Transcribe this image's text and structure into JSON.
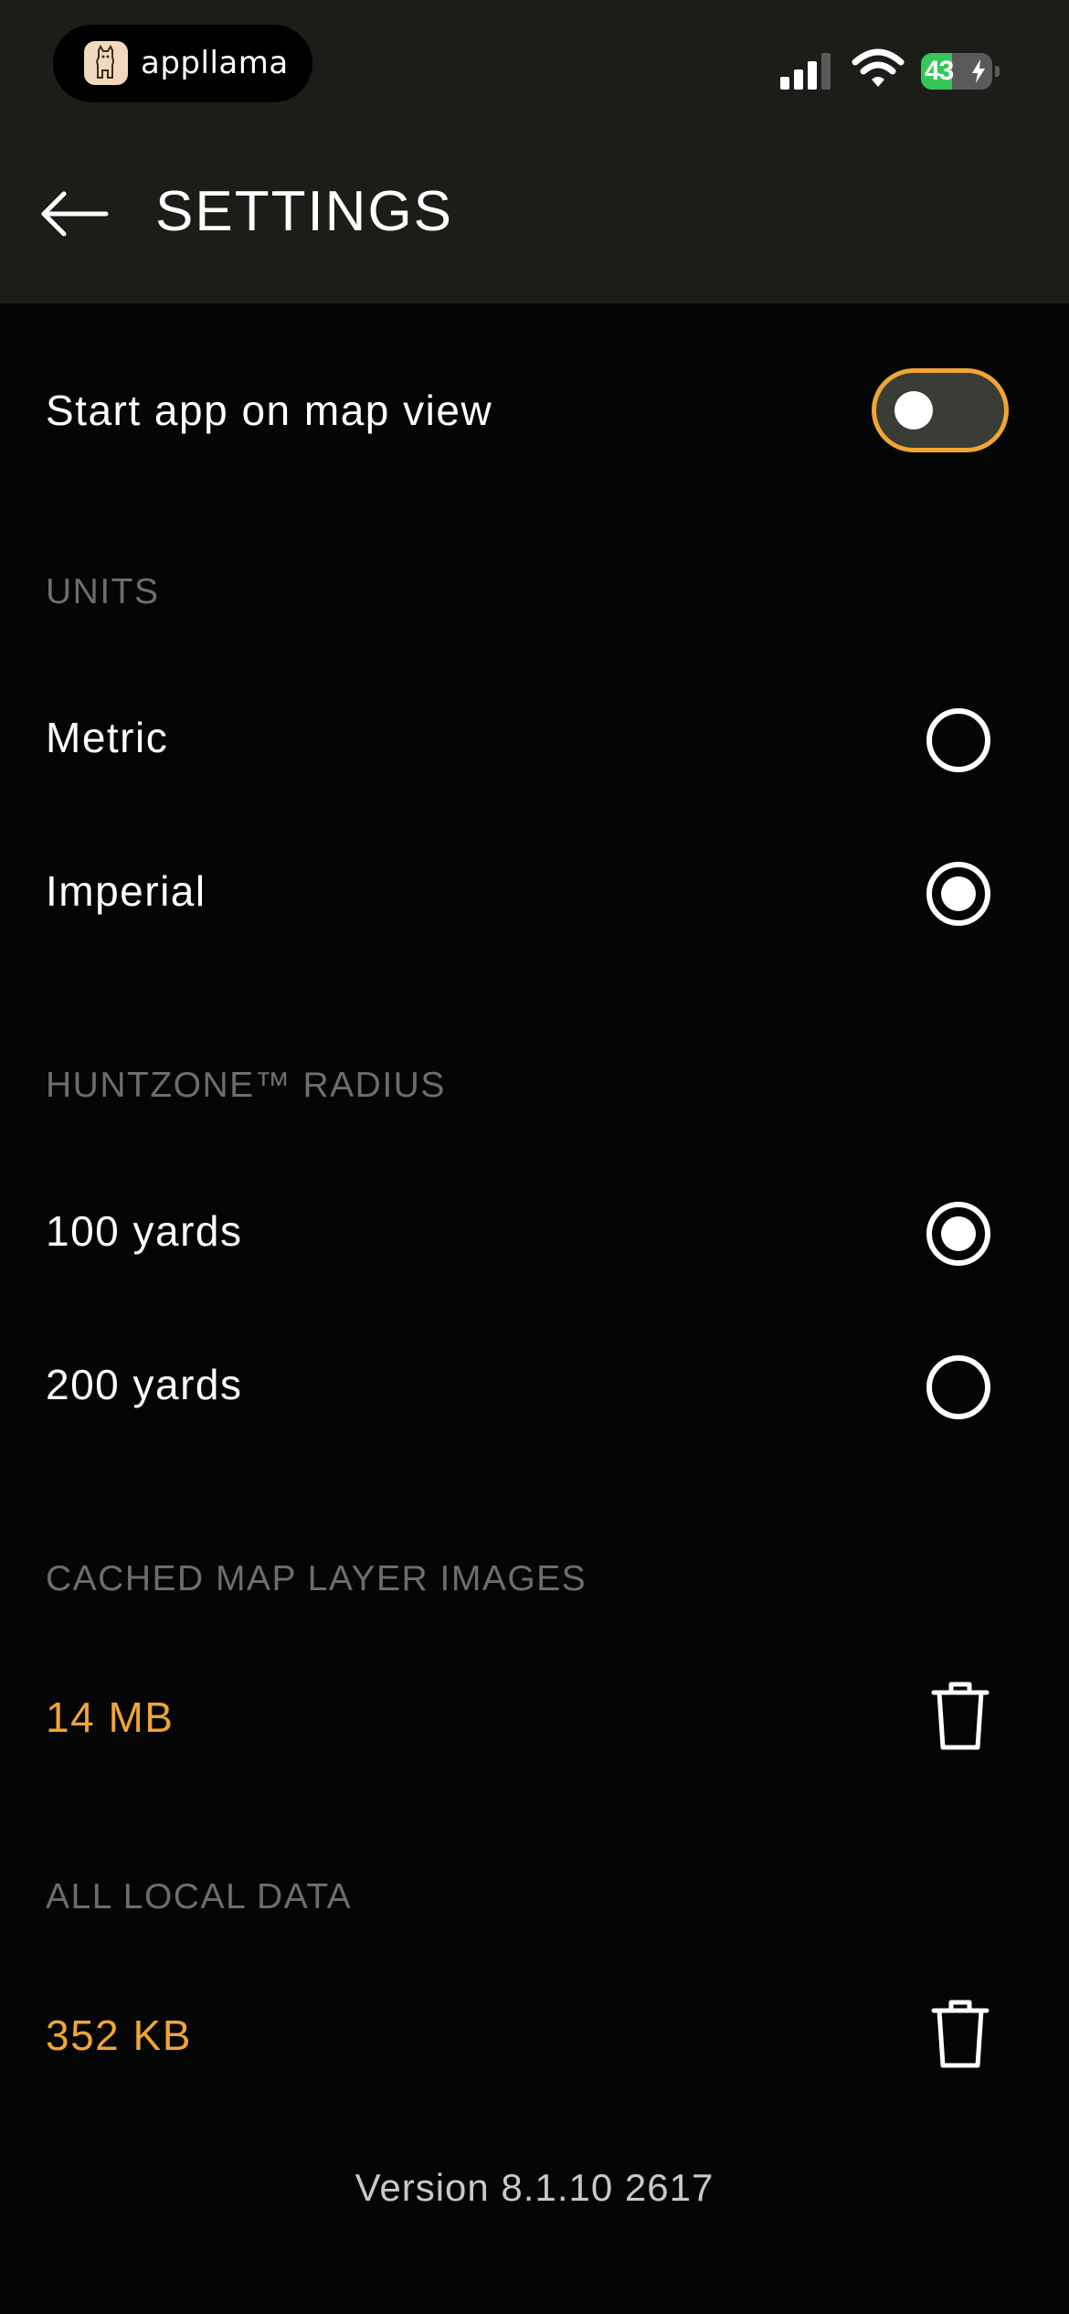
{
  "status_bar": {
    "app_name": "appllama",
    "battery_level": "43",
    "battery_fraction": 0.43
  },
  "header": {
    "title": "SETTINGS"
  },
  "settings": {
    "start_on_map": {
      "label": "Start app on map view",
      "enabled": false
    },
    "units": {
      "header": "UNITS",
      "options": [
        {
          "label": "Metric",
          "selected": false
        },
        {
          "label": "Imperial",
          "selected": true
        }
      ]
    },
    "huntzone_radius": {
      "header": "HUNTZONE™ RADIUS",
      "options": [
        {
          "label": "100 yards",
          "selected": true
        },
        {
          "label": "200 yards",
          "selected": false
        }
      ]
    },
    "cached_map": {
      "header": "CACHED MAP LAYER IMAGES",
      "size": "14 MB"
    },
    "local_data": {
      "header": "ALL LOCAL DATA",
      "size": "352 KB"
    }
  },
  "footer": {
    "version": "Version 8.1.10 2617"
  },
  "colors": {
    "accent": "#f0a535",
    "header_bg": "#1b1e18",
    "background": "#040606",
    "section_header": "#6c6e6b",
    "battery_green": "#35c759"
  },
  "icons": {
    "back": "arrow-left-icon",
    "trash": "trash-icon",
    "signal": "cellular-signal-icon",
    "wifi": "wifi-icon",
    "battery": "battery-icon"
  }
}
